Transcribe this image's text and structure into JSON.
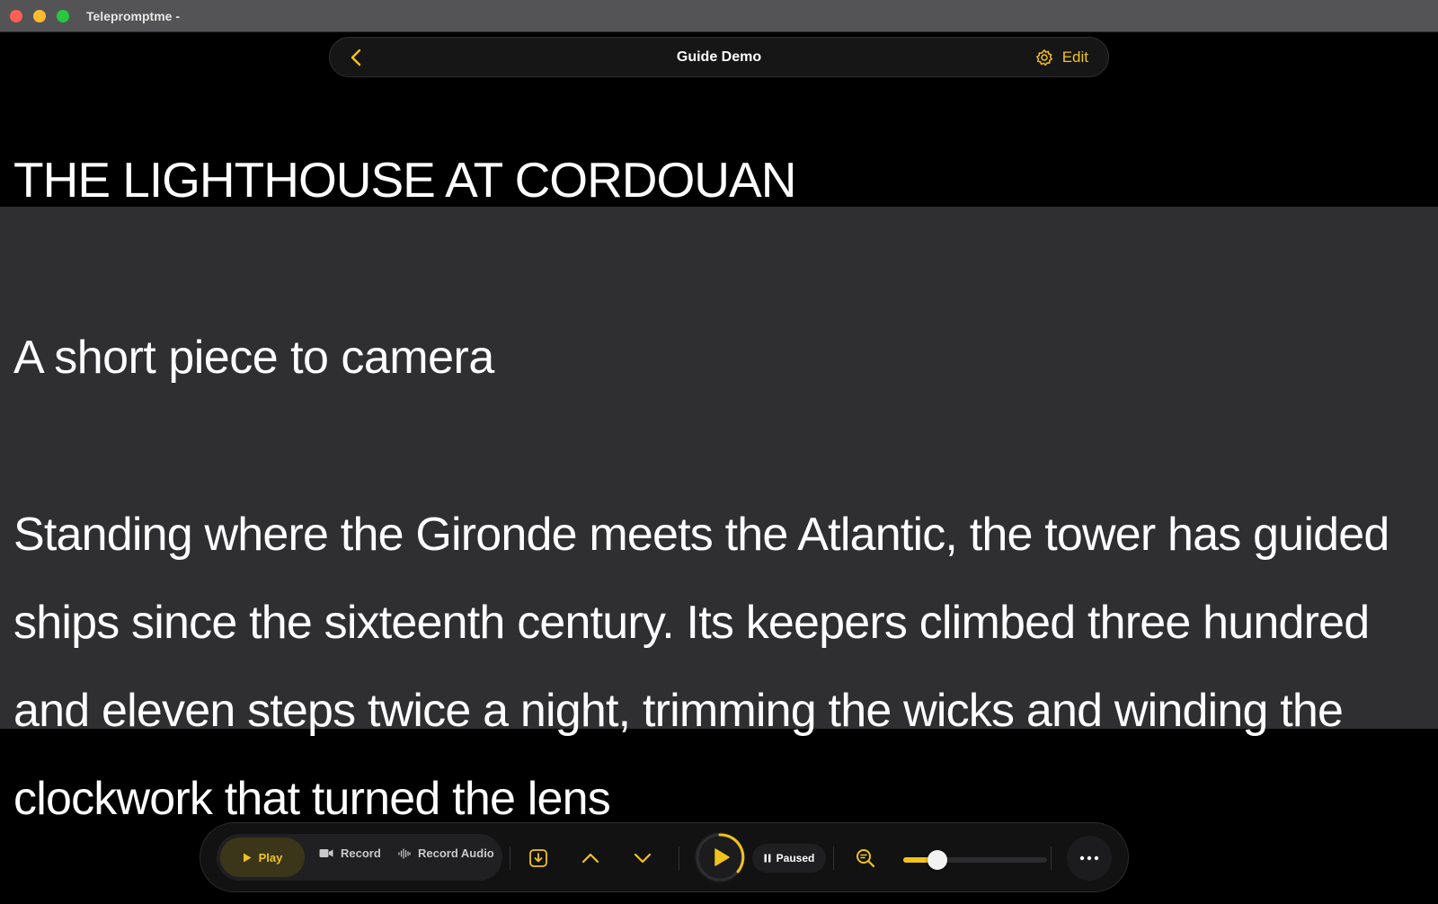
{
  "window": {
    "title": "Telepromptme -"
  },
  "topbar": {
    "back_icon": "chevron-left-icon",
    "title": "Guide Demo",
    "settings_icon": "gear-icon",
    "edit_label": "Edit"
  },
  "script": {
    "heading": "THE LIGHTHOUSE AT CORDOUAN",
    "subheading": "A short piece to camera",
    "paragraph_lines": [
      "Standing where the Gironde meets the Atlantic, the tower has guided",
      "ships since the sixteenth century. Its keepers climbed three hundred",
      "and eleven steps twice a night, trimming the wicks and winding the",
      "clockwork that turned the lens"
    ]
  },
  "toolbar": {
    "modes": [
      {
        "label": "Play",
        "icon": "play-icon",
        "selected": true
      },
      {
        "label": "Record",
        "icon": "video-camera-icon",
        "selected": false
      },
      {
        "label": "Record Audio",
        "icon": "waveform-icon",
        "selected": false
      }
    ],
    "status": "Paused",
    "speed_fraction": 0.24,
    "colors": {
      "accent": "#f2c31b",
      "focus_band": "#2f2f31",
      "background": "#000000"
    }
  }
}
